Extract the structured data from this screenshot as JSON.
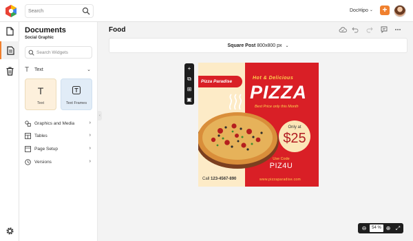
{
  "app": {
    "search_placeholder": "Search",
    "account_name": "DocHipo",
    "add_label": "+"
  },
  "panel": {
    "title": "Documents",
    "subtitle": "Social Graphic",
    "widget_search_placeholder": "Search Widgets",
    "section_text": "Text",
    "tiles": [
      {
        "glyph": "T",
        "label": "Text"
      },
      {
        "glyph": "T",
        "label": "Text Frames"
      }
    ],
    "nav": [
      {
        "label": "Graphics and Media",
        "icon": "shapes-icon"
      },
      {
        "label": "Tables",
        "icon": "table-icon"
      },
      {
        "label": "Page Setup",
        "icon": "page-setup-icon"
      },
      {
        "label": "Versions",
        "icon": "versions-icon"
      }
    ]
  },
  "canvas": {
    "doc_title": "Food",
    "format_name": "Square Post",
    "format_size": "800x800 px",
    "zoom": "54 %"
  },
  "design": {
    "brand": "Pizza Paradise",
    "tagline": "Hot & Delicious",
    "headline": "PIZZA",
    "subline": "Best Price only this Month",
    "only_at": "Only at",
    "price": "$25",
    "use_code_label": "Use Code",
    "code": "PIZ4U",
    "call_label": "Call",
    "phone": "123-4567-890",
    "website": "www.pizzaparadise.com"
  },
  "colors": {
    "accent": "#f0802e",
    "design_red": "#d91f26",
    "design_cream": "#fdebc7",
    "design_yellow": "#ffd44e"
  }
}
